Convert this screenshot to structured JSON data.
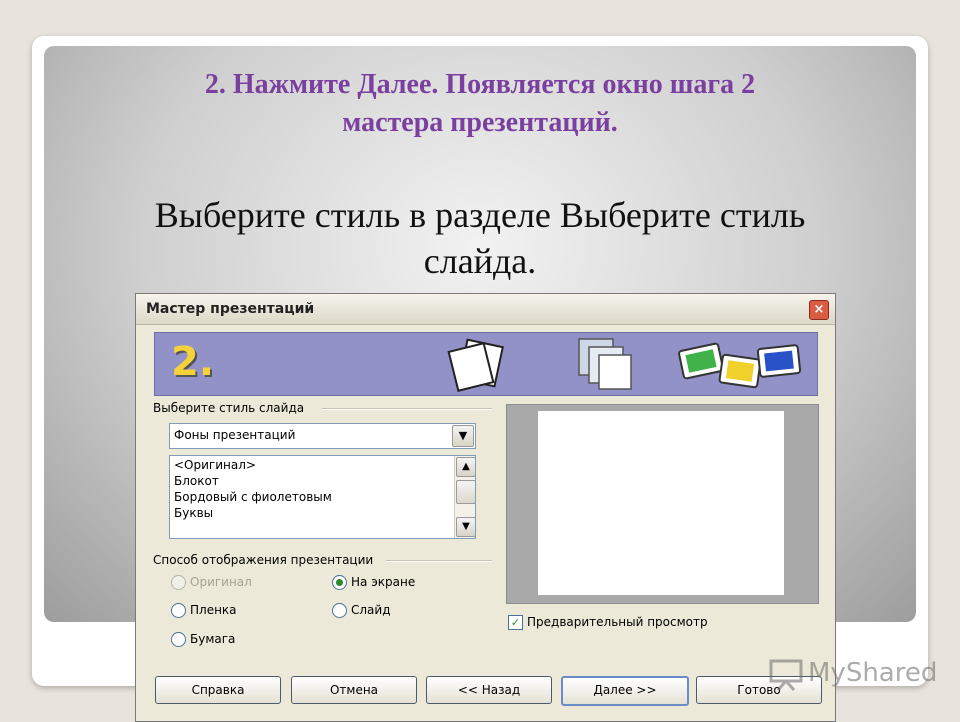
{
  "slide": {
    "title_lines": [
      "2. Нажмите Далее. Появляется окно шага 2",
      "мастера презентаций."
    ],
    "body_lines": [
      "Выберите стиль в разделе Выберите стиль",
      "слайда."
    ],
    "title_color": "#7b3fa0"
  },
  "dialog": {
    "title": "Мастер презентаций",
    "close_glyph": "×",
    "step_number": "2.",
    "style_group_label": "Выберите стиль слайда",
    "style_dropdown_value": "Фоны презентаций",
    "style_list": [
      "<Оригинал>",
      "Блокот",
      "Бордовый с фиолетовым",
      "Буквы"
    ],
    "display_group_label": "Способ отображения презентации",
    "radios": [
      {
        "label": "Оригинал",
        "checked": false,
        "disabled": true
      },
      {
        "label": "На экране",
        "checked": true,
        "disabled": false
      },
      {
        "label": "Пленка",
        "checked": false,
        "disabled": false
      },
      {
        "label": "Слайд",
        "checked": false,
        "disabled": false
      },
      {
        "label": "Бумага",
        "checked": false,
        "disabled": false
      }
    ],
    "preview_checkbox_label": "Предварительный просмотр",
    "preview_checked": true,
    "buttons": {
      "help": "Справка",
      "cancel": "Отмена",
      "back": "<< Назад",
      "next": "Далее >>",
      "finish": "Готово"
    }
  },
  "watermark": {
    "text": "MyShared"
  }
}
